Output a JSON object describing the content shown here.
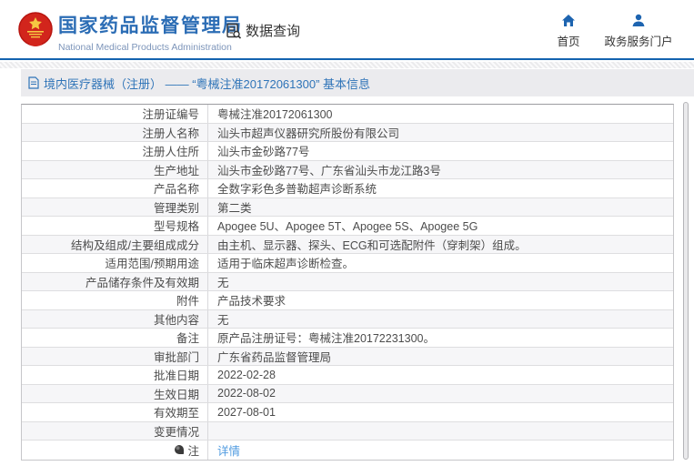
{
  "header": {
    "brand": {
      "title": "国家药品监督管理局",
      "subtitle": "National Medical Products Administration"
    },
    "data_query_label": "数据查询",
    "nav": [
      {
        "label": "首页"
      },
      {
        "label": "政务服务门户"
      }
    ]
  },
  "breadcrumb": {
    "text": "境内医疗器械（注册） —— “粤械注准20172061300” 基本信息"
  },
  "table": {
    "rows": [
      {
        "label": "注册证编号",
        "value": "粤械注准20172061300"
      },
      {
        "label": "注册人名称",
        "value": "汕头市超声仪器研究所股份有限公司"
      },
      {
        "label": "注册人住所",
        "value": "汕头市金砂路77号"
      },
      {
        "label": "生产地址",
        "value": "汕头市金砂路77号、广东省汕头市龙江路3号"
      },
      {
        "label": "产品名称",
        "value": "全数字彩色多普勒超声诊断系统"
      },
      {
        "label": "管理类别",
        "value": "第二类"
      },
      {
        "label": "型号规格",
        "value": "Apogee 5U、Apogee 5T、Apogee 5S、Apogee 5G"
      },
      {
        "label": "结构及组成/主要组成成分",
        "value": "由主机、显示器、探头、ECG和可选配附件（穿刺架）组成。"
      },
      {
        "label": "适用范围/预期用途",
        "value": "适用于临床超声诊断检查。"
      },
      {
        "label": "产品储存条件及有效期",
        "value": "无"
      },
      {
        "label": "附件",
        "value": "产品技术要求"
      },
      {
        "label": "其他内容",
        "value": "无"
      },
      {
        "label": "备注",
        "value": "原产品注册证号：粤械注准20172231300。"
      },
      {
        "label": "审批部门",
        "value": "广东省药品监督管理局"
      },
      {
        "label": "批准日期",
        "value": "2022-02-28"
      },
      {
        "label": "生效日期",
        "value": "2022-08-02"
      },
      {
        "label": "有效期至",
        "value": "2027-08-01"
      },
      {
        "label": "变更情况",
        "value": ""
      },
      {
        "label": "注",
        "value": "详情",
        "link": true,
        "icon": "note-balloon-icon"
      }
    ]
  },
  "colors": {
    "accent_blue": "#2c6db5",
    "header_rule_blue": "#1463af",
    "breadcrumb_blue": "#2f74b8",
    "link_blue": "#4f9be0",
    "emblem_red": "#d2251c",
    "emblem_gold": "#f5c842",
    "row_alt_bg": "#f6f6f8",
    "text_dark": "#4c4c4c"
  }
}
